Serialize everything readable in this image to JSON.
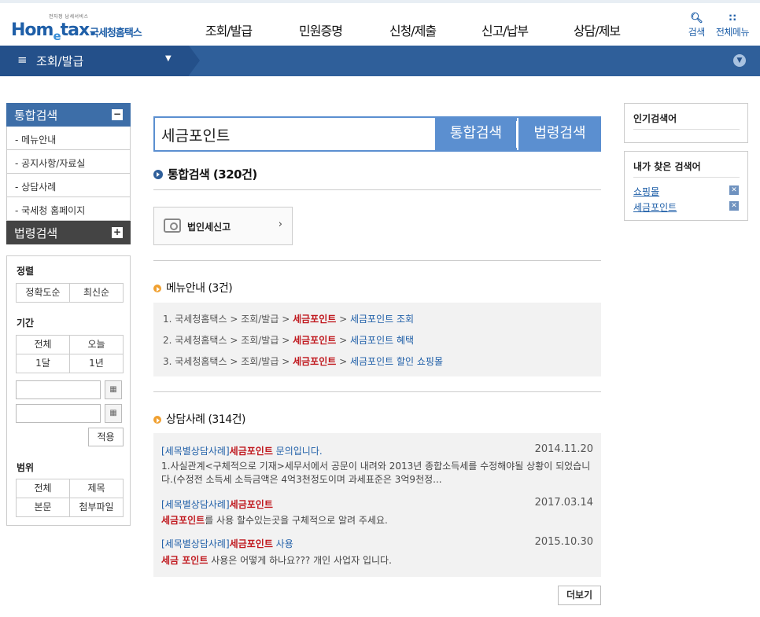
{
  "header": {
    "logo_tag": "전자정 납세서비스",
    "logo_home": "Hom",
    "logo_e": "e",
    "logo_tax": "tax.",
    "logo_korean": "국세청홈택스",
    "nav": [
      "조회/발급",
      "민원증명",
      "신청/제출",
      "신고/납부",
      "상담/제보"
    ],
    "search_label": "검색",
    "allmenu_label": "전체메뉴"
  },
  "locbar": {
    "current": "조회/발급"
  },
  "sidebar": {
    "integrated_title": "통합검색",
    "items": [
      "- 메뉴안내",
      "- 공지사항/자료실",
      "- 상담사례",
      "- 국세청 홈페이지"
    ],
    "law_title": "법령검색"
  },
  "filter": {
    "sort_title": "정렬",
    "sort_options": [
      "정확도순",
      "최신순"
    ],
    "period_title": "기간",
    "period_options": [
      "전체",
      "오늘",
      "1달",
      "1년"
    ],
    "apply_label": "적용",
    "scope_title": "범위",
    "scope_options": [
      "전체",
      "제목",
      "본문",
      "첨부파일"
    ]
  },
  "search": {
    "query": "세금포인트",
    "integrated_button": "통합검색",
    "law_button": "법령검색"
  },
  "results": {
    "total_title": "통합검색 (320건)",
    "shortcut_label": "법인세신고",
    "menu_title": "메뉴안내 (3건)",
    "menu_rows": [
      {
        "prefix": "1. 국세청홈택스 > 조회/발급 > ",
        "hit": "세금포인트",
        "sep": " > ",
        "link": "세금포인트 조회"
      },
      {
        "prefix": "2. 국세청홈택스 > 조회/발급 > ",
        "hit": "세금포인트",
        "sep": " > ",
        "link": "세금포인트 혜택"
      },
      {
        "prefix": "3. 국세청홈택스 > 조회/발급 > ",
        "hit": "세금포인트",
        "sep": " > ",
        "link": "세금포인트 할인 쇼핑몰"
      }
    ],
    "qa_title": "상담사례 (314건)",
    "qa_items": [
      {
        "cat": "[세목별상담사례]",
        "hit": "세금포인트",
        "rest": " 문의입니다.",
        "date": "2014.11.20",
        "body": "1.사실관계<구체적으로 기재>세무서에서 공문이 내려와 2013년 종합소득세를 수정해야될 상황이 되었습니다.(수정전 소득세 소득금액은 4억3천정도이며 과세표준은 3억9천정..."
      },
      {
        "cat": "[세목별상담사례]",
        "hit": "세금포인트",
        "rest": "",
        "date": "2017.03.14",
        "body_hit": "세금포인트",
        "body": "를 사용 할수있는곳을 구체적으로 알려 주세요."
      },
      {
        "cat": "[세목별상담사례]",
        "hit": "세금포인트",
        "rest": " 사용",
        "date": "2015.10.30",
        "body_hit": "세금 포인트",
        "body": " 사용은 어떻게 하나요??? 개인 사업자 입니다."
      }
    ],
    "more_label": "더보기"
  },
  "right": {
    "popular_title": "인기검색어",
    "mine_title": "내가 찾은 검색어",
    "mine_keywords": [
      "쇼핑몰",
      "세금포인트"
    ]
  },
  "colors": {
    "primary": "#2f5f9a",
    "search_blue": "#5b8fd0",
    "highlight_red": "#c0191f"
  }
}
